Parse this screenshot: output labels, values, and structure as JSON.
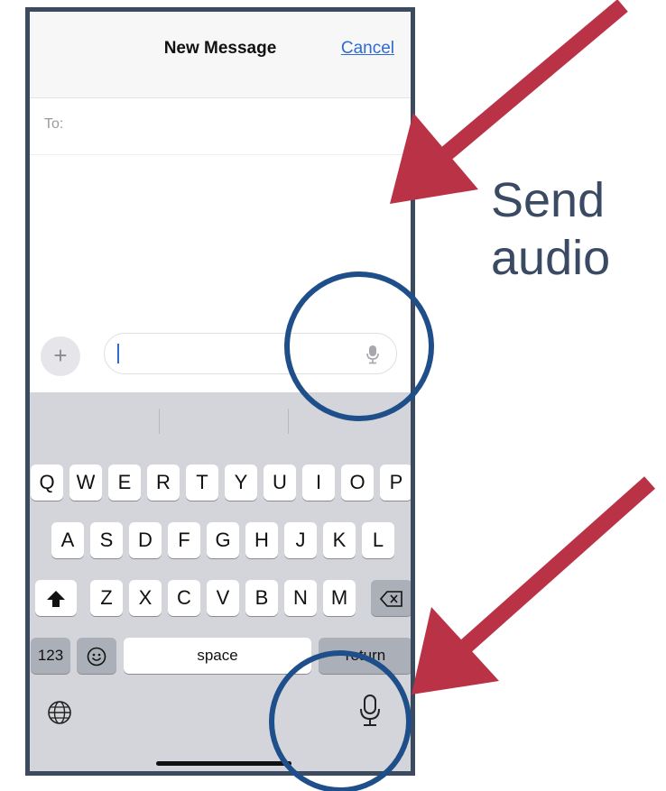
{
  "header": {
    "title": "New Message",
    "cancel_label": "Cancel"
  },
  "recipient": {
    "label": "To:"
  },
  "composer": {
    "plus_label": "+",
    "mic_icon": "microphone-icon"
  },
  "keyboard": {
    "row1": [
      "Q",
      "W",
      "E",
      "R",
      "T",
      "Y",
      "U",
      "I",
      "O",
      "P"
    ],
    "row2": [
      "A",
      "S",
      "D",
      "F",
      "G",
      "H",
      "J",
      "K",
      "L"
    ],
    "row3": [
      "Z",
      "X",
      "C",
      "V",
      "B",
      "N",
      "M"
    ],
    "numbers_label": "123",
    "space_label": "space",
    "return_label": "return",
    "shift_icon": "shift-icon",
    "delete_icon": "delete-icon",
    "emoji_icon": "emoji-icon",
    "globe_icon": "globe-icon"
  },
  "annotation": {
    "line1": "Send",
    "line2": "audio",
    "arrow_color": "#b93246",
    "circle_color": "#1f4f8a"
  }
}
